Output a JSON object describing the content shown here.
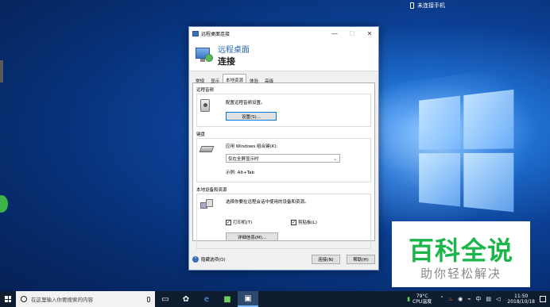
{
  "notification": {
    "text": "未连接手机"
  },
  "dialog": {
    "title": "远程桌面连接",
    "header_line1": "远程桌面",
    "header_line2": "连接",
    "controls": {
      "minimize": "—",
      "maximize": "☐",
      "close": "✕"
    },
    "tabs": [
      "常规",
      "显示",
      "本地资源",
      "体验",
      "高级"
    ],
    "active_tab": "本地资源",
    "remote_audio": {
      "label": "远程音频",
      "desc": "配置远程音频设置。",
      "button": "设置(S)..."
    },
    "keyboard": {
      "label": "键盘",
      "desc": "应用 Windows 组合键(K):",
      "select_value": "仅在全屏显示时",
      "example": "示例: Alt+Tab"
    },
    "local_devices": {
      "label": "本地设备和资源",
      "desc": "选择你要在远程会话中使用的设备和资源。",
      "printer": {
        "label": "打印机(T)",
        "checked": true
      },
      "clipboard": {
        "label": "剪贴板(L)",
        "checked": true
      },
      "button": "详细信息(M)..."
    },
    "footer": {
      "hide_options": "隐藏选项(O)",
      "connect": "连接(N)",
      "help": "帮助(H)"
    }
  },
  "watermark": {
    "big": "百科全说",
    "small": "助你轻松解决"
  },
  "taskbar": {
    "search_placeholder": "在这里输入你要搜索的内容",
    "temp": "79°C",
    "temp_label": "CPU温度",
    "time": "11:50",
    "date": "2018/10/18"
  }
}
